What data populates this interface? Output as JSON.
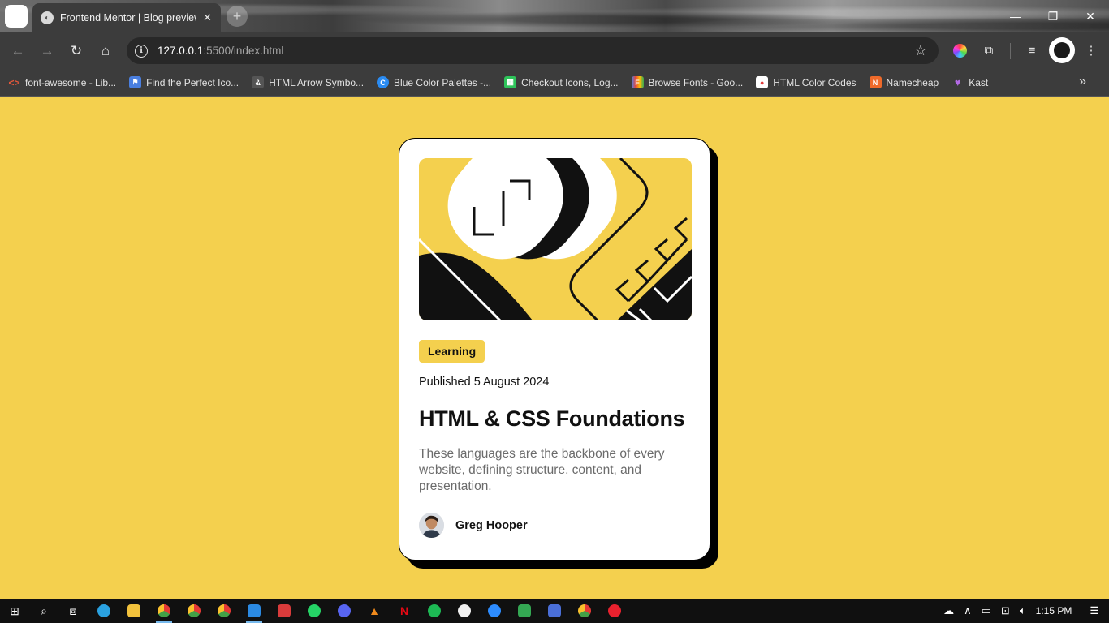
{
  "browser": {
    "tab_title": "Frontend Mentor | Blog preview",
    "url_host": "127.0.0.1",
    "url_rest": ":5500/index.html",
    "bookmarks": [
      {
        "label": "font-awesome - Lib...",
        "icon": "code-icon",
        "color": "#e8583b"
      },
      {
        "label": "Find the Perfect Ico...",
        "icon": "flag-icon",
        "color": "#4a7fe0"
      },
      {
        "label": "HTML Arrow Symbo...",
        "icon": "entity-icon",
        "color": "#555555"
      },
      {
        "label": "Blue Color Palettes -...",
        "icon": "circle-c-icon",
        "color": "#2a8bf2"
      },
      {
        "label": "Checkout Icons, Log...",
        "icon": "grid-icon",
        "color": "#2ec45a"
      },
      {
        "label": "Browse Fonts - Goo...",
        "icon": "fonts-icon",
        "color": "#e8a33b"
      },
      {
        "label": "HTML Color Codes",
        "icon": "color-drop-icon",
        "color": "#e33b3b"
      },
      {
        "label": "Namecheap",
        "icon": "namecheap-icon",
        "color": "#ef6a2a"
      },
      {
        "label": "Kast",
        "icon": "kast-icon",
        "color": "#b46ae6"
      }
    ]
  },
  "card": {
    "tag": "Learning",
    "published": "Published 5 August 2024",
    "title": "HTML & CSS Foundations",
    "description": "These languages are the backbone of every website, defining structure, content, and presentation.",
    "author": "Greg Hooper"
  },
  "taskbar": {
    "time": "1:15 PM"
  },
  "colors": {
    "page_background": "#f4d04e",
    "card_background": "#ffffff",
    "shadow": "#000000",
    "tag_background": "#f4d04e",
    "text_dark": "#111111",
    "text_muted": "#6b6b6b"
  }
}
